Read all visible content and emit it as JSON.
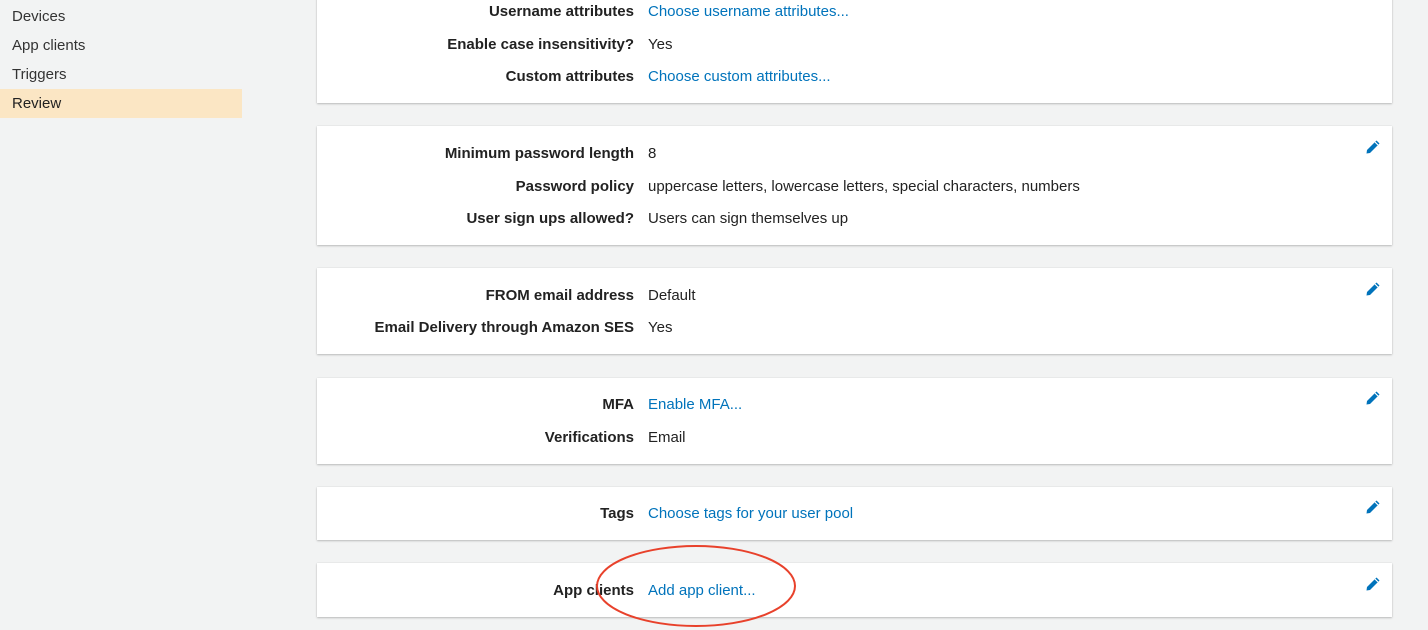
{
  "sidebar": {
    "items": [
      {
        "label": "Devices",
        "active": false
      },
      {
        "label": "App clients",
        "active": false
      },
      {
        "label": "Triggers",
        "active": false
      },
      {
        "label": "Review",
        "active": true
      }
    ]
  },
  "cards": {
    "attributes": {
      "username_label": "Username attributes",
      "username_value": "Choose username attributes...",
      "case_label": "Enable case insensitivity?",
      "case_value": "Yes",
      "custom_label": "Custom attributes",
      "custom_value": "Choose custom attributes..."
    },
    "policies": {
      "min_length_label": "Minimum password length",
      "min_length_value": "8",
      "policy_label": "Password policy",
      "policy_value": "uppercase letters, lowercase letters, special characters, numbers",
      "signup_label": "User sign ups allowed?",
      "signup_value": "Users can sign themselves up"
    },
    "email": {
      "from_label": "FROM email address",
      "from_value": "Default",
      "ses_label": "Email Delivery through Amazon SES",
      "ses_value": "Yes"
    },
    "mfa": {
      "mfa_label": "MFA",
      "mfa_value": "Enable MFA...",
      "verif_label": "Verifications",
      "verif_value": "Email"
    },
    "tags": {
      "tags_label": "Tags",
      "tags_value": "Choose tags for your user pool"
    },
    "app_clients": {
      "label": "App clients",
      "value": "Add app client..."
    }
  },
  "icons": {
    "edit": "pencil-icon"
  },
  "colors": {
    "link": "#0073bb",
    "active_nav": "#fbe6c4",
    "annotation": "#e8412b"
  }
}
